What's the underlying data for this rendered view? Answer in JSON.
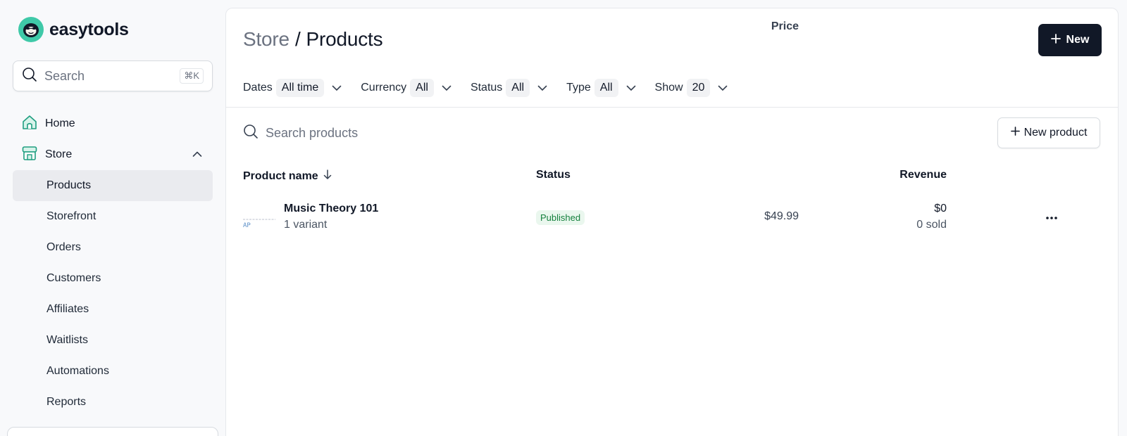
{
  "app": {
    "name": "easytools"
  },
  "search": {
    "placeholder": "Search",
    "shortcut": "⌘K"
  },
  "sidebar": {
    "home": "Home",
    "store": "Store",
    "items": [
      "Products",
      "Storefront",
      "Orders",
      "Customers",
      "Affiliates",
      "Waitlists",
      "Automations",
      "Reports"
    ],
    "active": "Products"
  },
  "header": {
    "parent": "Store",
    "separator": "/",
    "current": "Products",
    "new_button": "New"
  },
  "filters": [
    {
      "label": "Dates",
      "value": "All time"
    },
    {
      "label": "Currency",
      "value": "All"
    },
    {
      "label": "Status",
      "value": "All"
    },
    {
      "label": "Type",
      "value": "All"
    },
    {
      "label": "Show",
      "value": "20"
    }
  ],
  "products": {
    "search_placeholder": "Search products",
    "new_button": "New product",
    "columns": {
      "name": "Product name",
      "status": "Status",
      "price": "Price",
      "revenue": "Revenue"
    },
    "rows": [
      {
        "name": "Music Theory 101",
        "variants": "1 variant",
        "status": "Published",
        "price": "$49.99",
        "revenue": "$0",
        "sold": "0 sold"
      }
    ]
  },
  "colors": {
    "accent": "#3fc9a8",
    "primary_button": "#111827",
    "published_text": "#15803d",
    "published_bg": "#eaf7ee"
  },
  "icons": [
    "logo-icon",
    "search-icon",
    "home-icon",
    "store-icon",
    "chevron-up-icon",
    "plus-icon",
    "chevron-down-icon",
    "arrow-down-icon",
    "more-icon"
  ]
}
